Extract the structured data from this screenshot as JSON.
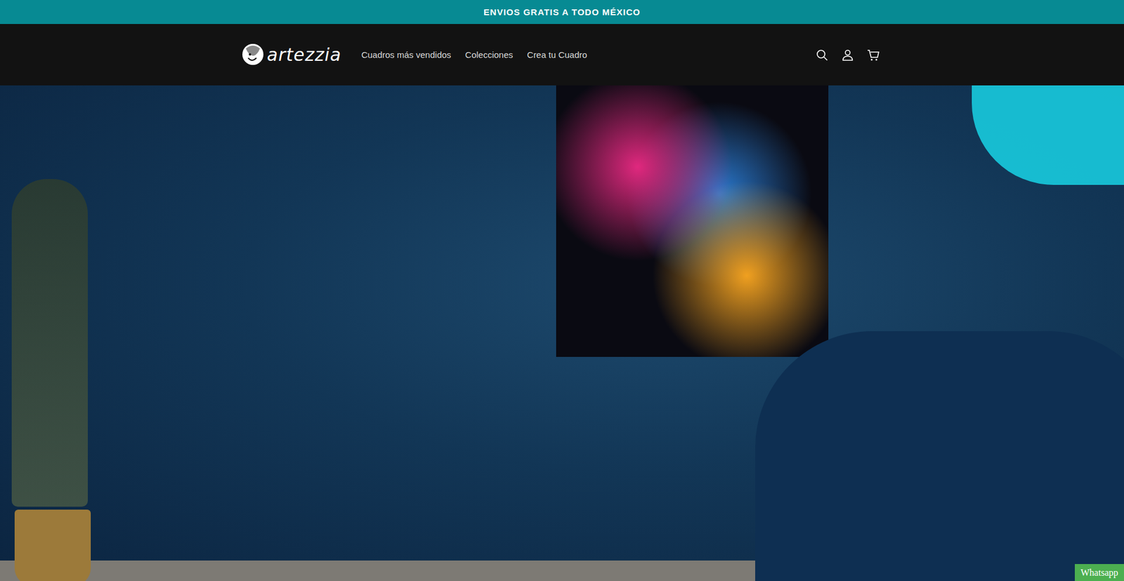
{
  "announcement": {
    "text": "ENVIOS GRATIS A TODO MÉXICO"
  },
  "header": {
    "logo": "artezzia",
    "nav": [
      {
        "label": "Cuadros más vendidos"
      },
      {
        "label": "Colecciones"
      },
      {
        "label": "Crea tu Cuadro"
      }
    ]
  },
  "whatsapp": {
    "label": "Whatsapp"
  }
}
